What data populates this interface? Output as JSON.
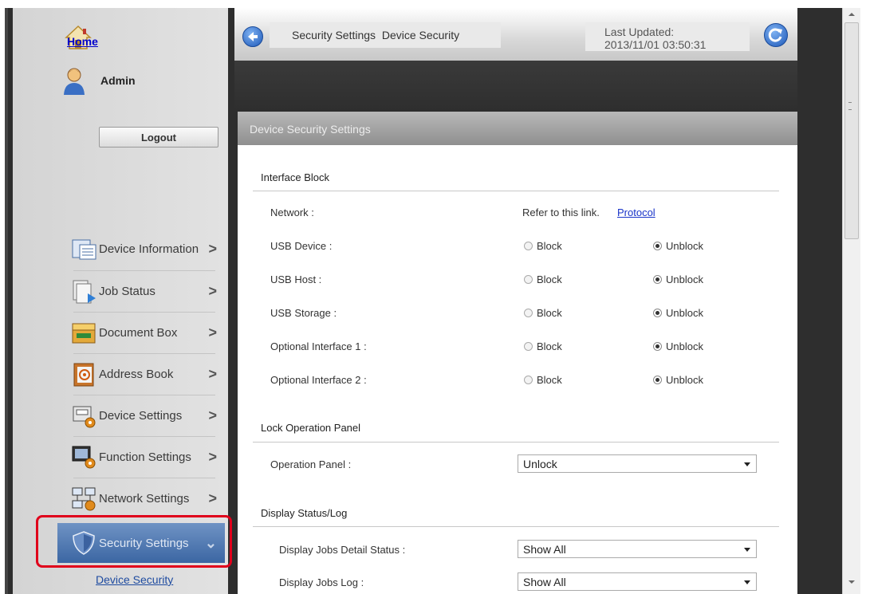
{
  "sidebar": {
    "home_label": "Home",
    "user_label": "Admin",
    "logout_label": "Logout",
    "menu": [
      {
        "label": "Device Information",
        "icon": "device-information-icon",
        "chevron": ">"
      },
      {
        "label": "Job Status",
        "icon": "job-status-icon",
        "chevron": ">"
      },
      {
        "label": "Document Box",
        "icon": "document-box-icon",
        "chevron": ">"
      },
      {
        "label": "Address Book",
        "icon": "address-book-icon",
        "chevron": ">"
      },
      {
        "label": "Device Settings",
        "icon": "device-settings-icon",
        "chevron": ">"
      },
      {
        "label": "Function Settings",
        "icon": "function-settings-icon",
        "chevron": ">"
      },
      {
        "label": "Network Settings",
        "icon": "network-settings-icon",
        "chevron": ">"
      },
      {
        "label": "Security Settings",
        "icon": "shield-icon",
        "chevron": "⌄",
        "active": true
      }
    ],
    "submenu_active": "Device Security"
  },
  "topbar": {
    "breadcrumb": [
      "Security Settings",
      "Device Security"
    ],
    "last_updated_label": "Last Updated:",
    "last_updated_value": "2013/11/01 03:50:31"
  },
  "panel": {
    "title": "Device Security Settings",
    "interface_block": {
      "title": "Interface Block",
      "network_label": "Network :",
      "network_hint": "Refer to this link.",
      "network_link": "Protocol",
      "option_block": "Block",
      "option_unblock": "Unblock",
      "rows": [
        {
          "label": "USB Device :",
          "value": "Unblock"
        },
        {
          "label": "USB Host :",
          "value": "Unblock"
        },
        {
          "label": "USB Storage :",
          "value": "Unblock"
        },
        {
          "label": "Optional Interface 1 :",
          "value": "Unblock"
        },
        {
          "label": "Optional Interface 2 :",
          "value": "Unblock"
        }
      ]
    },
    "lock_panel": {
      "title": "Lock Operation Panel",
      "label": "Operation Panel :",
      "value": "Unlock"
    },
    "display_status": {
      "title": "Display Status/Log",
      "rows": [
        {
          "label": "Display Jobs Detail Status :",
          "value": "Show All"
        },
        {
          "label": "Display Jobs Log :",
          "value": "Show All"
        }
      ]
    }
  },
  "colors": {
    "highlight": "#e0001b",
    "active_menu": "#3b66a3",
    "link": "#1a35c9"
  }
}
